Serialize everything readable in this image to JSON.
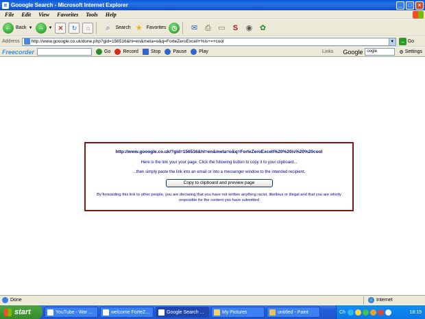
{
  "window": {
    "title": "Gooogle Search - Microsoft Internet Explorer"
  },
  "menu": [
    "File",
    "Edit",
    "View",
    "Favorites",
    "Tools",
    "Help"
  ],
  "toolbar": {
    "back_label": "Back",
    "search_label": "Search",
    "favorites_label": "Favorites"
  },
  "address": {
    "label": "Address",
    "url": "http://www.gooogle.co.uk/done.php?gid=156516&hl=en&meta=o&q=ForteZeroExcell+%is+=+cool",
    "go_label": "Go"
  },
  "extbar": {
    "brand": "Freecorder",
    "go_label": "Go",
    "record_label": "Record",
    "stop_label": "Stop",
    "pause_label": "Pause",
    "play_label": "Play",
    "links_label": "Links",
    "google_label": "Google",
    "google_field": "oogle",
    "settings_label": "Settings"
  },
  "content": {
    "link": "http://www.gooogle.co.uk/?gid=156516&hl=en&meta=o&q=ForteZeroExcell%20%20is%20%20cool",
    "line1": "Here is the link your your page. Click the following button to copy it to your clipboard...",
    "line2": "...then simply paste the link into an email or into a messenger window to the intended recipient.",
    "button_label": "Copy to clipboard and preview page",
    "legal": "By forwarding this link to other people, you are declaring that you have not written anything racist, libellous or illegal and that you are wholly resposible for the content you have submitted"
  },
  "status": {
    "text": "Done",
    "zone": "Internet"
  },
  "taskbar": {
    "start_label": "start",
    "tasks": [
      "YouTube - War ...",
      "welcome ForteZ...",
      "Google Search ...",
      "My Pictures",
      "untitled - Paint"
    ],
    "clock": "18:19",
    "tray_text": "Ch"
  }
}
